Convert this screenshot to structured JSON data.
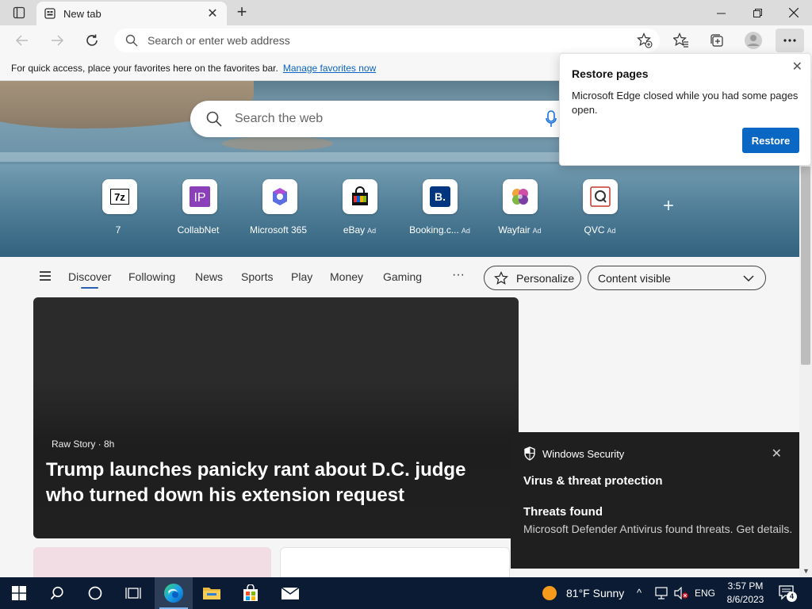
{
  "browser": {
    "tab_title": "New tab",
    "address_placeholder": "Search or enter web address"
  },
  "favorites_bar": {
    "message": "For quick access, place your favorites here on the favorites bar.",
    "link": "Manage favorites now"
  },
  "ntp": {
    "search_placeholder": "Search the web",
    "tiles": [
      {
        "label": "7",
        "ad": ""
      },
      {
        "label": "CollabNet",
        "ad": ""
      },
      {
        "label": "Microsoft 365",
        "ad": ""
      },
      {
        "label": "eBay",
        "ad": "Ad"
      },
      {
        "label": "Booking.c...",
        "ad": "Ad"
      },
      {
        "label": "Wayfair",
        "ad": "Ad"
      },
      {
        "label": "QVC",
        "ad": "Ad"
      }
    ],
    "tile_icons": {
      "t0": "7z",
      "t1": "IP",
      "t4": "B."
    },
    "feed_nav": [
      "Discover",
      "Following",
      "News",
      "Sports",
      "Play",
      "Money",
      "Gaming"
    ],
    "more": "···",
    "personalize": "Personalize",
    "content_visible": "Content visible"
  },
  "feed": {
    "hero_source": "Raw Story · 8h",
    "hero_headline": "Trump launches panicky rant about D.C. judge who turned down his extension request"
  },
  "restore_popup": {
    "title": "Restore pages",
    "message": "Microsoft Edge closed while you had some pages open.",
    "button": "Restore"
  },
  "toast": {
    "app": "Windows Security",
    "heading": "Virus & threat protection",
    "subheading": "Threats found",
    "body": "Microsoft Defender Antivirus found threats. Get details."
  },
  "taskbar": {
    "weather": "81°F  Sunny",
    "lang": "ENG",
    "time": "3:57 PM",
    "date": "8/6/2023",
    "notifications": "4"
  },
  "colors": {
    "accent": "#0a67c4",
    "taskbar": "#0b1b33",
    "link": "#0b63c5"
  }
}
